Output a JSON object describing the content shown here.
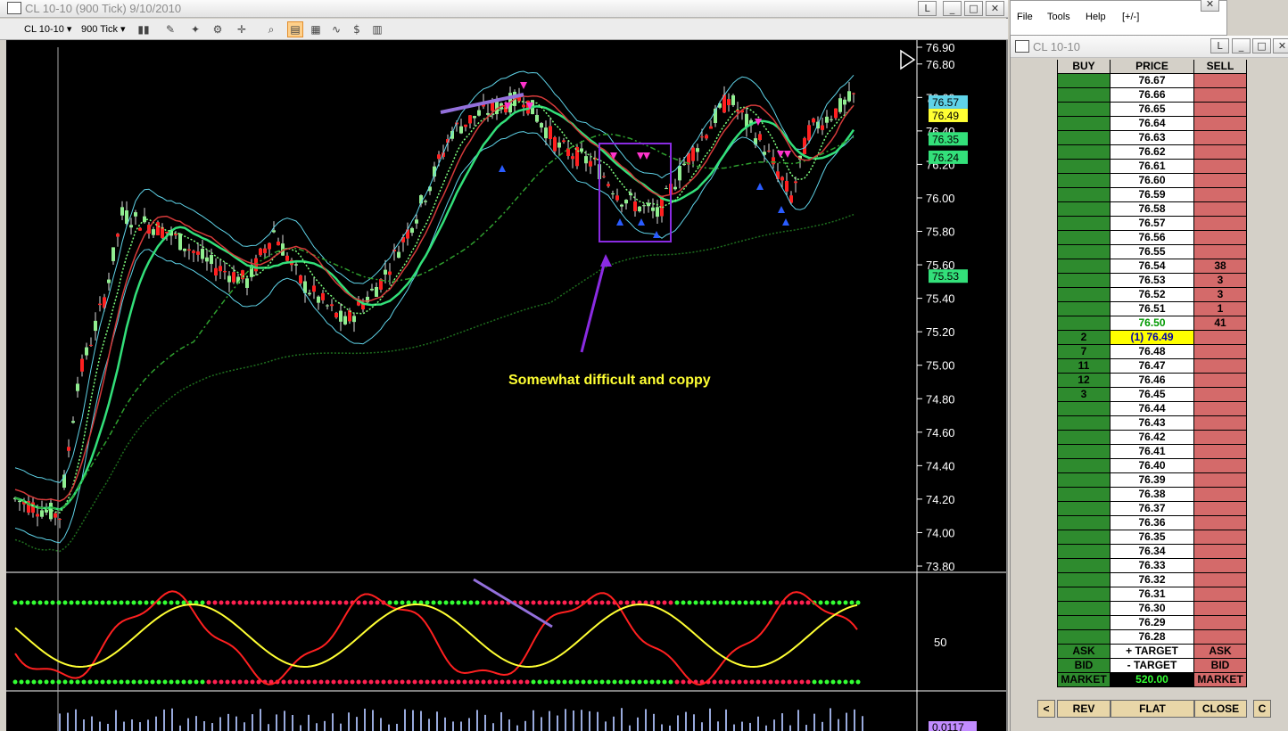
{
  "chart_window": {
    "title": "CL 10-10 (900 Tick)  9/10/2010",
    "instrument_combo": "CL 10-10",
    "period_combo": "900 Tick",
    "restore_btn": "L",
    "annotation": "Somewhat difficult and coppy",
    "price_axis": [
      "76.90",
      "76.80",
      "76.60",
      "76.40",
      "76.20",
      "76.00",
      "75.80",
      "75.60",
      "75.40",
      "75.20",
      "75.00",
      "74.80",
      "74.60",
      "74.40",
      "74.20",
      "74.00",
      "73.80"
    ],
    "price_markers": [
      "76.57",
      "76.49",
      "76.35",
      "76.24",
      "75.53"
    ],
    "indicator_axis": "50",
    "bottom_marker": "0.0117",
    "colors": {
      "up_candle": "#90ee90",
      "down_candle": "#ff2020",
      "purple_line": "#9370db",
      "cyan_band": "#5fd3e8"
    }
  },
  "menu": {
    "items": [
      "File",
      "Tools",
      "Help",
      "[+/-]"
    ]
  },
  "ladder_window": {
    "title": "CL 10-10",
    "restore_btn": "L",
    "headers": {
      "buy": "BUY",
      "price": "PRICE",
      "sell": "SELL"
    },
    "rows": [
      {
        "price": "76.67",
        "buy": "",
        "sell": ""
      },
      {
        "price": "76.66",
        "buy": "",
        "sell": ""
      },
      {
        "price": "76.65",
        "buy": "",
        "sell": ""
      },
      {
        "price": "76.64",
        "buy": "",
        "sell": ""
      },
      {
        "price": "76.63",
        "buy": "",
        "sell": ""
      },
      {
        "price": "76.62",
        "buy": "",
        "sell": ""
      },
      {
        "price": "76.61",
        "buy": "",
        "sell": ""
      },
      {
        "price": "76.60",
        "buy": "",
        "sell": ""
      },
      {
        "price": "76.59",
        "buy": "",
        "sell": ""
      },
      {
        "price": "76.58",
        "buy": "",
        "sell": ""
      },
      {
        "price": "76.57",
        "buy": "",
        "sell": ""
      },
      {
        "price": "76.56",
        "buy": "",
        "sell": ""
      },
      {
        "price": "76.55",
        "buy": "",
        "sell": ""
      },
      {
        "price": "76.54",
        "buy": "",
        "sell": "38"
      },
      {
        "price": "76.53",
        "buy": "",
        "sell": "3"
      },
      {
        "price": "76.52",
        "buy": "",
        "sell": "3"
      },
      {
        "price": "76.51",
        "buy": "",
        "sell": "1"
      },
      {
        "price": "76.50",
        "buy": "",
        "sell": "41"
      },
      {
        "price": "(1) 76.49",
        "buy": "2",
        "sell": ""
      },
      {
        "price": "76.48",
        "buy": "7",
        "sell": ""
      },
      {
        "price": "76.47",
        "buy": "11",
        "sell": ""
      },
      {
        "price": "76.46",
        "buy": "12",
        "sell": ""
      },
      {
        "price": "76.45",
        "buy": "3",
        "sell": ""
      },
      {
        "price": "76.44",
        "buy": "",
        "sell": ""
      },
      {
        "price": "76.43",
        "buy": "",
        "sell": ""
      },
      {
        "price": "76.42",
        "buy": "",
        "sell": ""
      },
      {
        "price": "76.41",
        "buy": "",
        "sell": ""
      },
      {
        "price": "76.40",
        "buy": "",
        "sell": ""
      },
      {
        "price": "76.39",
        "buy": "",
        "sell": ""
      },
      {
        "price": "76.38",
        "buy": "",
        "sell": ""
      },
      {
        "price": "76.37",
        "buy": "",
        "sell": ""
      },
      {
        "price": "76.36",
        "buy": "",
        "sell": ""
      },
      {
        "price": "76.35",
        "buy": "",
        "sell": ""
      },
      {
        "price": "76.34",
        "buy": "",
        "sell": ""
      },
      {
        "price": "76.33",
        "buy": "",
        "sell": ""
      },
      {
        "price": "76.32",
        "buy": "",
        "sell": ""
      },
      {
        "price": "76.31",
        "buy": "",
        "sell": ""
      },
      {
        "price": "76.30",
        "buy": "",
        "sell": ""
      },
      {
        "price": "76.29",
        "buy": "",
        "sell": ""
      },
      {
        "price": "76.28",
        "buy": "",
        "sell": ""
      }
    ],
    "footer": [
      {
        "buy": "ASK",
        "price": "+ TARGET",
        "sell": "ASK"
      },
      {
        "buy": "BID",
        "price": "- TARGET",
        "sell": "BID"
      },
      {
        "buy": "MARKET",
        "price": "520.00",
        "sell": "MARKET"
      }
    ],
    "buttons": {
      "prev": "<",
      "rev": "REV",
      "flat": "FLAT",
      "close": "CLOSE",
      "c": "C"
    }
  }
}
